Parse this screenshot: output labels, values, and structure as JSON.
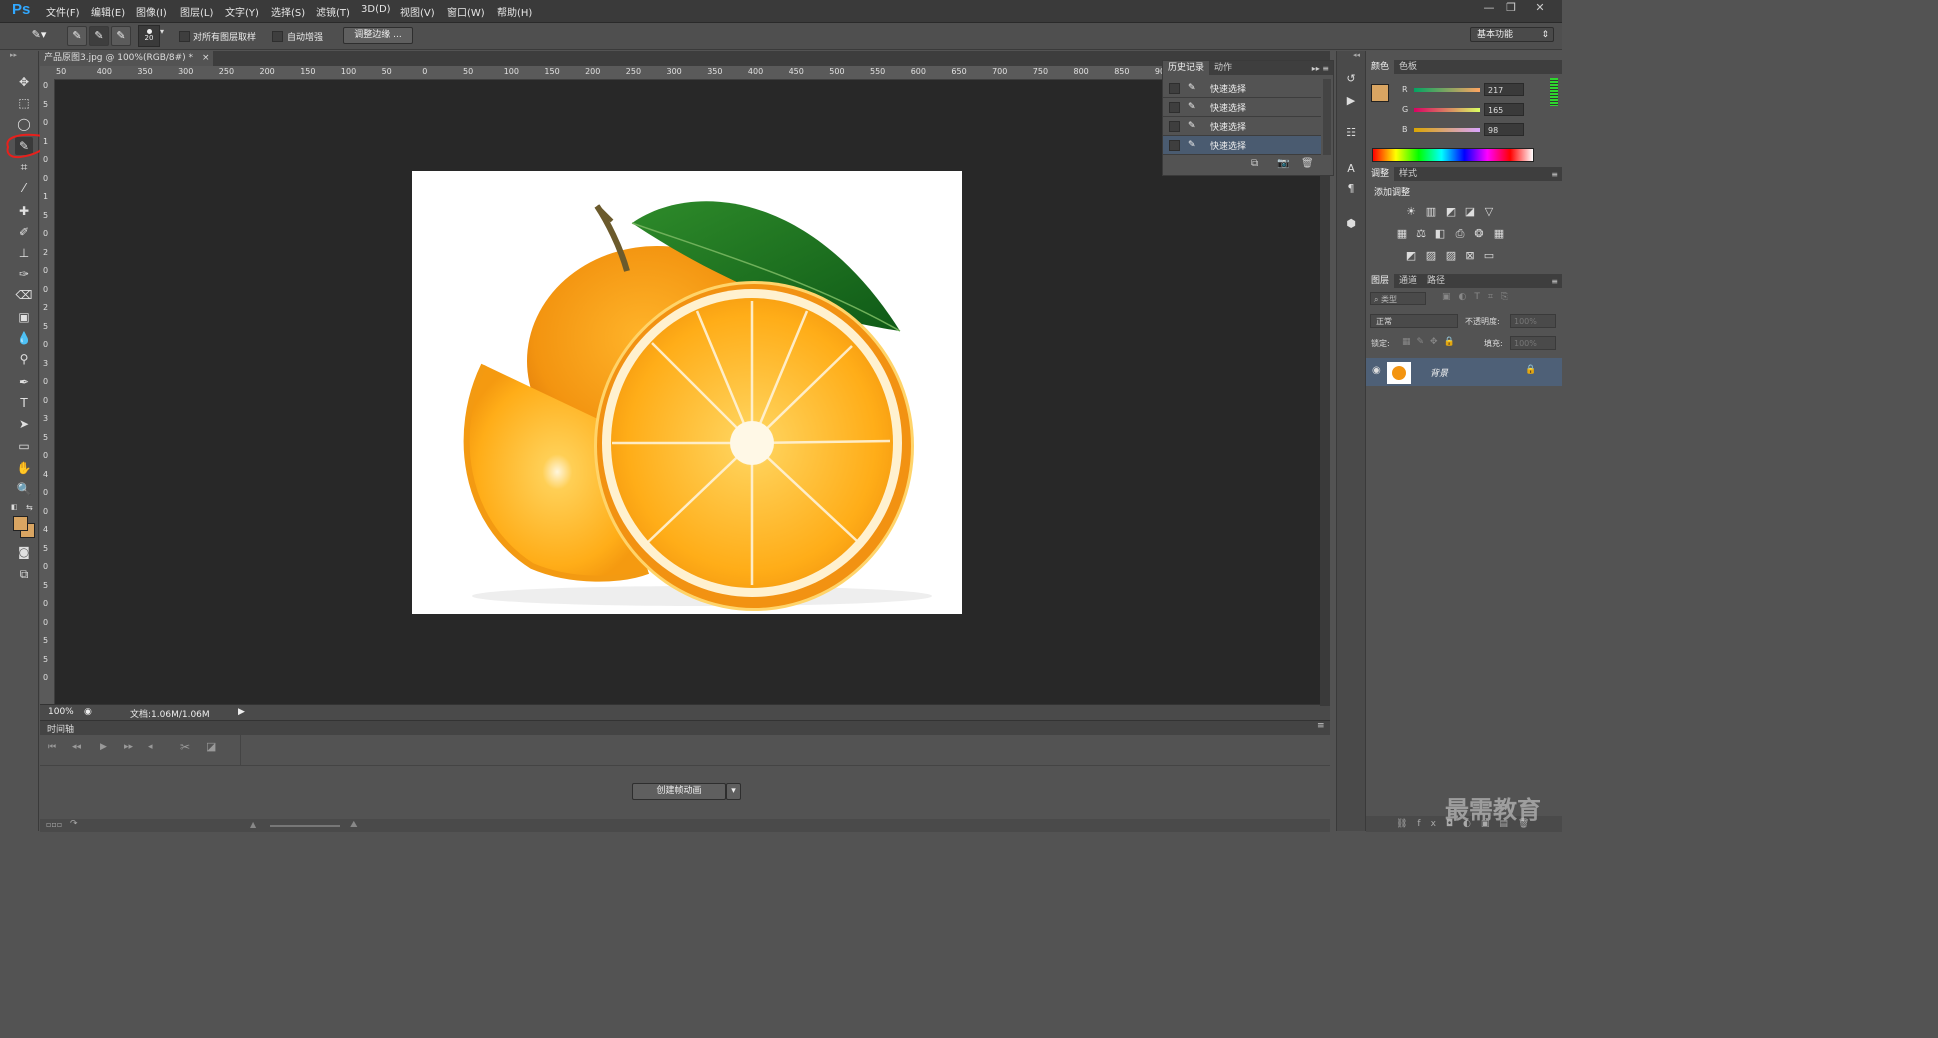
{
  "app": {
    "logo": "Ps"
  },
  "menu": [
    {
      "label": "文件(F)"
    },
    {
      "label": "编辑(E)"
    },
    {
      "label": "图像(I)"
    },
    {
      "label": "图层(L)"
    },
    {
      "label": "文字(Y)"
    },
    {
      "label": "选择(S)"
    },
    {
      "label": "滤镜(T)"
    },
    {
      "label": "3D(D)"
    },
    {
      "label": "视图(V)"
    },
    {
      "label": "窗口(W)"
    },
    {
      "label": "帮助(H)"
    }
  ],
  "options": {
    "brush_size": "20",
    "sample_all_layers": "对所有图层取样",
    "auto_enhance": "自动增强",
    "refine_edge": "调整边缘 ...",
    "workspace": "基本功能"
  },
  "document": {
    "tab_title": "产品原图3.jpg @ 100%(RGB/8#) *",
    "close": "×",
    "zoom": "100%",
    "doc_size": "文档:1.06M/1.06M"
  },
  "ruler": {
    "h_ticks": [
      "50",
      "400",
      "350",
      "300",
      "250",
      "200",
      "150",
      "100",
      "50",
      "0",
      "50",
      "100",
      "150",
      "200",
      "250",
      "300",
      "350",
      "400",
      "450",
      "500",
      "550",
      "600",
      "650",
      "700",
      "750",
      "800",
      "850",
      "900"
    ],
    "v_ticks": [
      "0",
      "5",
      "0",
      "1",
      "0",
      "0",
      "1",
      "5",
      "0",
      "2",
      "0",
      "0",
      "2",
      "5",
      "0",
      "3",
      "0",
      "0",
      "3",
      "5",
      "0",
      "4",
      "0",
      "0",
      "4",
      "5",
      "0",
      "5",
      "0",
      "0",
      "5",
      "5",
      "0"
    ]
  },
  "history": {
    "tabs": [
      "历史记录",
      "动作"
    ],
    "items": [
      "快速选择",
      "快速选择",
      "快速选择",
      "快速选择"
    ]
  },
  "color": {
    "tabs": [
      "颜色",
      "色板"
    ],
    "r_label": "R",
    "g_label": "G",
    "b_label": "B",
    "r": "217",
    "g": "165",
    "b": "98",
    "swatch": "#d9a562"
  },
  "adjustments": {
    "tabs": [
      "调整",
      "样式"
    ],
    "title": "添加调整"
  },
  "layers": {
    "tabs": [
      "图层",
      "通道",
      "路径"
    ],
    "filter": "类型",
    "blend": "正常",
    "opacity_label": "不透明度:",
    "opacity": "100%",
    "lock_label": "锁定:",
    "fill_label": "填充:",
    "fill": "100%",
    "layer_name": "背景"
  },
  "timeline": {
    "title": "时间轴",
    "create": "创建帧动画"
  },
  "watermark": "最需教育"
}
